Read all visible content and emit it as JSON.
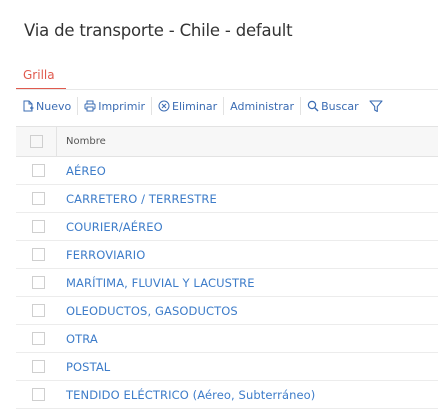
{
  "page": {
    "title": "Via de transporte - Chile - default"
  },
  "tabs": [
    {
      "label": "Grilla",
      "active": true
    }
  ],
  "toolbar": {
    "buttons": [
      {
        "label": "Nuevo",
        "icon": "new-document-icon"
      },
      {
        "label": "Imprimir",
        "icon": "printer-icon"
      },
      {
        "label": "Eliminar",
        "icon": "delete-circle-icon"
      },
      {
        "label": "Administrar"
      },
      {
        "label": "Buscar",
        "icon": "search-icon"
      }
    ],
    "filter_icon": "filter-icon"
  },
  "grid": {
    "columns": [
      {
        "header": "Nombre"
      }
    ],
    "rows": [
      {
        "nombre": "AÉREO"
      },
      {
        "nombre": "CARRETERO / TERRESTRE"
      },
      {
        "nombre": "COURIER/AÉREO"
      },
      {
        "nombre": "FERROVIARIO"
      },
      {
        "nombre": "MARÍTIMA, FLUVIAL Y LACUSTRE"
      },
      {
        "nombre": "OLEODUCTOS, GASODUCTOS"
      },
      {
        "nombre": "OTRA"
      },
      {
        "nombre": "POSTAL"
      },
      {
        "nombre": "TENDIDO ELÉCTRICO (Aéreo, Subterráneo)"
      }
    ]
  },
  "colors": {
    "accent": "#e05a4e",
    "link": "#3d7cc9",
    "toolbar_link": "#3b6cb3"
  }
}
